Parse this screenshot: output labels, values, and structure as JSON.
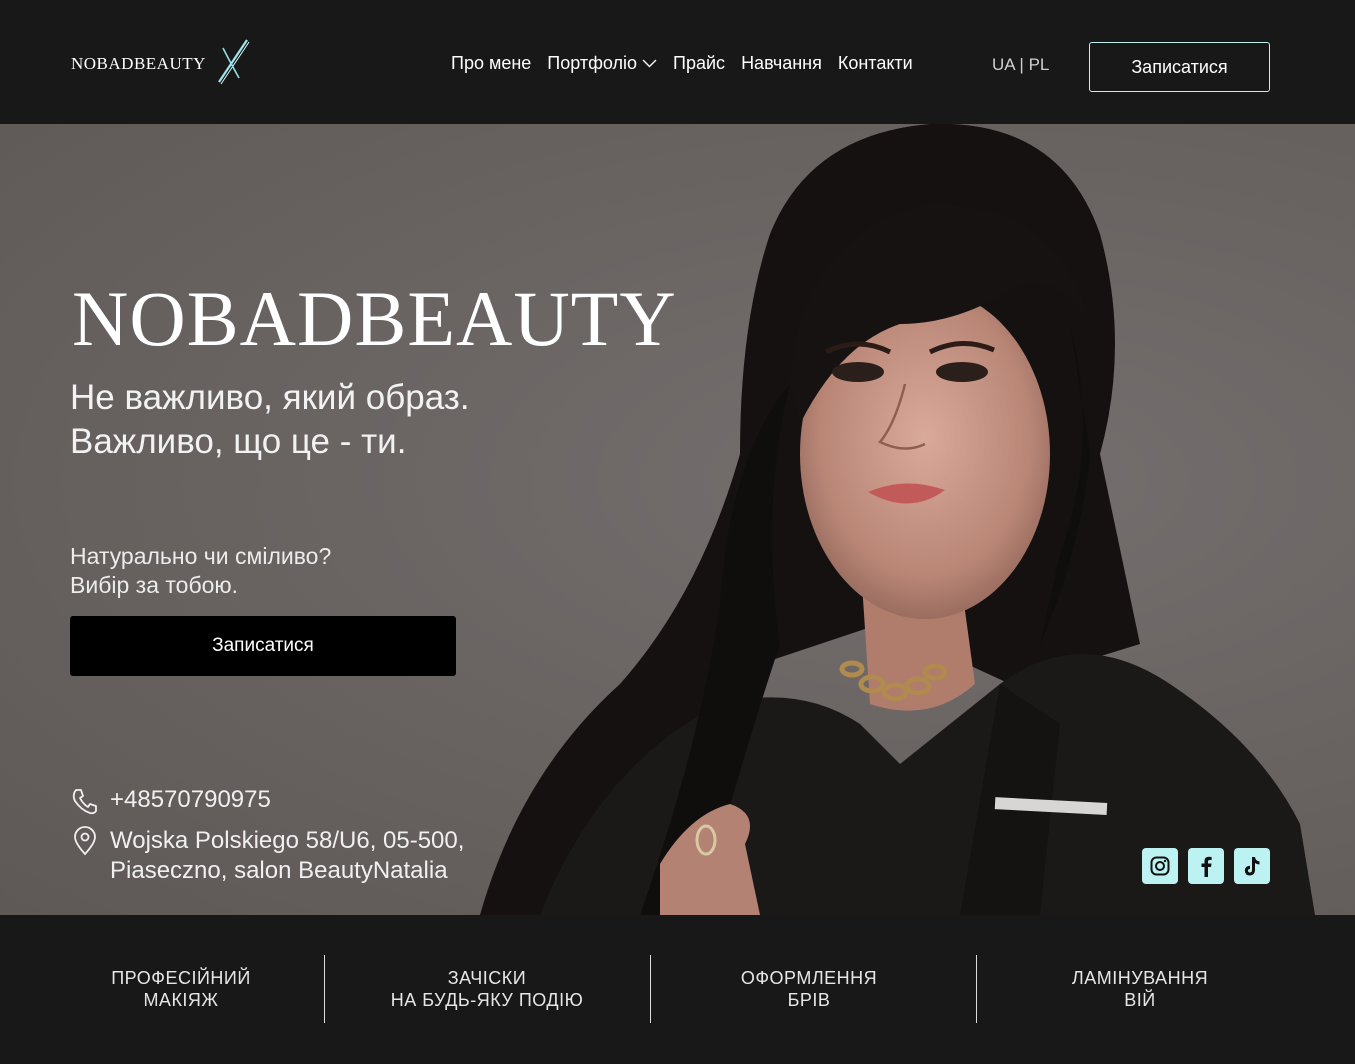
{
  "header": {
    "logo_text": "NOBADBEAUTY",
    "nav": [
      "Про мене",
      "Портфоліо",
      "Прайс",
      "Навчання",
      "Контакти"
    ],
    "lang_ua": "UA",
    "lang_sep": " | ",
    "lang_pl": "PL",
    "cta": "Записатися"
  },
  "hero": {
    "title": "NOBADBEAUTY",
    "subtitle_line1": "Не важливо, який образ.",
    "subtitle_line2": "Важливо, що це - ти.",
    "question_line1": "Натурально чи сміливо?",
    "question_line2": "Вибір за тобою.",
    "cta": "Записатися",
    "phone": "+48570790975",
    "address_line1": "Wojska Polskiego 58/U6, 05-500,",
    "address_line2": "Piaseczno, salon BeautyNatalia"
  },
  "social": [
    "instagram-icon",
    "facebook-icon",
    "tiktok-icon"
  ],
  "services": [
    {
      "line1": "ПРОФЕСІЙНИЙ",
      "line2": "МАКІЯЖ"
    },
    {
      "line1": "ЗАЧІСКИ",
      "line2": "НА БУДЬ-ЯКУ ПОДІЮ"
    },
    {
      "line1": "ОФОРМЛЕННЯ",
      "line2": "БРІВ"
    },
    {
      "line1": "ЛАМІНУВАННЯ",
      "line2": "ВІЙ"
    }
  ],
  "colors": {
    "background": "#181818",
    "accent": "#bdf2f3",
    "button_dark": "#000000"
  }
}
